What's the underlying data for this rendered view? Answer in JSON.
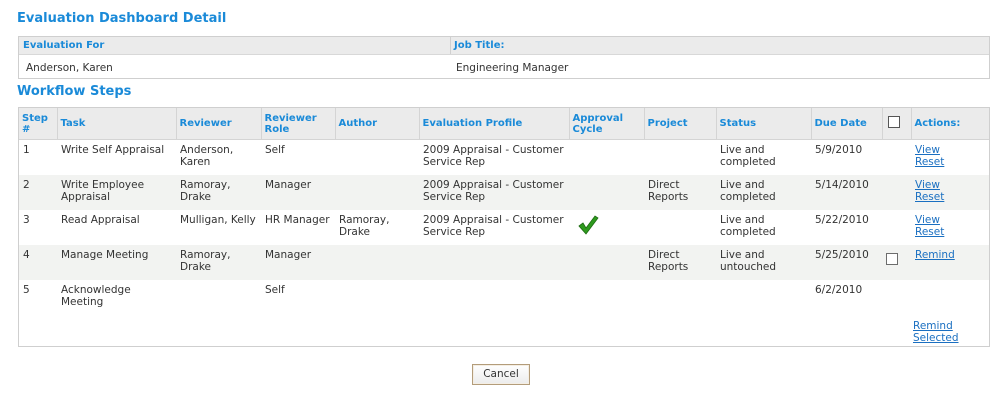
{
  "page": {
    "title": "Evaluation Dashboard Detail",
    "workflow_title": "Workflow Steps",
    "cancel_label": "Cancel",
    "remind_selected_label": "Remind Selected"
  },
  "evaluation": {
    "for_label": "Evaluation For",
    "for_value": "Anderson, Karen",
    "job_label": "Job Title:",
    "job_value": "Engineering Manager"
  },
  "workflow": {
    "columns": [
      "Step #",
      "Task",
      "Reviewer",
      "Reviewer Role",
      "Author",
      "Evaluation Profile",
      "Approval Cycle",
      "Project",
      "Status",
      "Due Date",
      "",
      "Actions:"
    ],
    "rows": [
      {
        "step": "1",
        "task": "Write Self Appraisal",
        "reviewer": "Anderson, Karen",
        "role": "Self",
        "author": "",
        "profile": "2009 Appraisal - Customer Service Rep",
        "approval": "",
        "project": "",
        "status": "Live and completed",
        "due": "5/9/2010",
        "checkbox": false,
        "actions": [
          "View",
          "Reset"
        ]
      },
      {
        "step": "2",
        "task": "Write Employee Appraisal",
        "reviewer": "Ramoray, Drake",
        "role": "Manager",
        "author": "",
        "profile": "2009 Appraisal - Customer Service Rep",
        "approval": "",
        "project": "Direct Reports",
        "status": "Live and completed",
        "due": "5/14/2010",
        "checkbox": false,
        "actions": [
          "View",
          "Reset"
        ]
      },
      {
        "step": "3",
        "task": "Read Appraisal",
        "reviewer": "Mulligan, Kelly",
        "role": "HR Manager",
        "author": "Ramoray, Drake",
        "profile": "2009 Appraisal - Customer Service Rep",
        "approval": "check",
        "project": "",
        "status": "Live and completed",
        "due": "5/22/2010",
        "checkbox": false,
        "actions": [
          "View",
          "Reset"
        ]
      },
      {
        "step": "4",
        "task": "Manage Meeting",
        "reviewer": "Ramoray, Drake",
        "role": "Manager",
        "author": "",
        "profile": "",
        "approval": "",
        "project": "Direct Reports",
        "status": "Live and untouched",
        "due": "5/25/2010",
        "checkbox": true,
        "actions": [
          "Remind"
        ]
      },
      {
        "step": "5",
        "task": "Acknowledge Meeting",
        "reviewer": "",
        "role": "Self",
        "author": "",
        "profile": "",
        "approval": "",
        "project": "",
        "status": "",
        "due": "6/2/2010",
        "checkbox": false,
        "actions": []
      }
    ]
  },
  "colors": {
    "accent": "#1a8ad8",
    "link": "#1a6fc1",
    "header_bg": "#ebebeb",
    "alt_row": "#f2f3f1",
    "check": "#2e9a1e"
  }
}
